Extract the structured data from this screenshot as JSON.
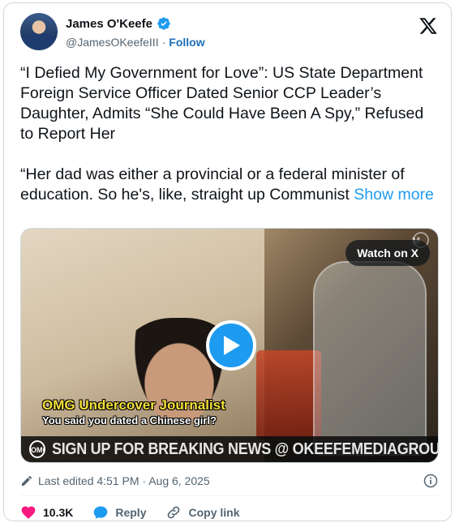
{
  "author": {
    "name": "James O'Keefe",
    "handle": "@JamesOKeefeIII",
    "separator": "·",
    "follow_label": "Follow"
  },
  "tweet": {
    "paragraph1": "“I Defied My Government for Love”: US State Department Foreign Service Officer Dated Senior CCP Leader’s Daughter, Admits “She Could Have Been A Spy,” Refused to Report Her",
    "paragraph2": "“Her dad was either a provincial or a federal minister of education. So he's, like, straight up Communist",
    "show_more": "Show more"
  },
  "media": {
    "watch_label": "Watch on X",
    "caption_title": "OMG Undercover Journalist",
    "caption_line": "You said you dated a Chinese girl?",
    "banner_text": "SIGN UP FOR BREAKING NEWS @ OKEEFEMEDIAGROUP.COM",
    "logo_text": "OMG"
  },
  "meta": {
    "edited_text": "Last edited 4:51 PM · Aug 6, 2025"
  },
  "actions": {
    "likes": "10.3K",
    "reply": "Reply",
    "copy_link": "Copy link"
  },
  "colors": {
    "accent": "#1d9bf0",
    "like": "#f91880",
    "text_secondary": "#536471"
  }
}
